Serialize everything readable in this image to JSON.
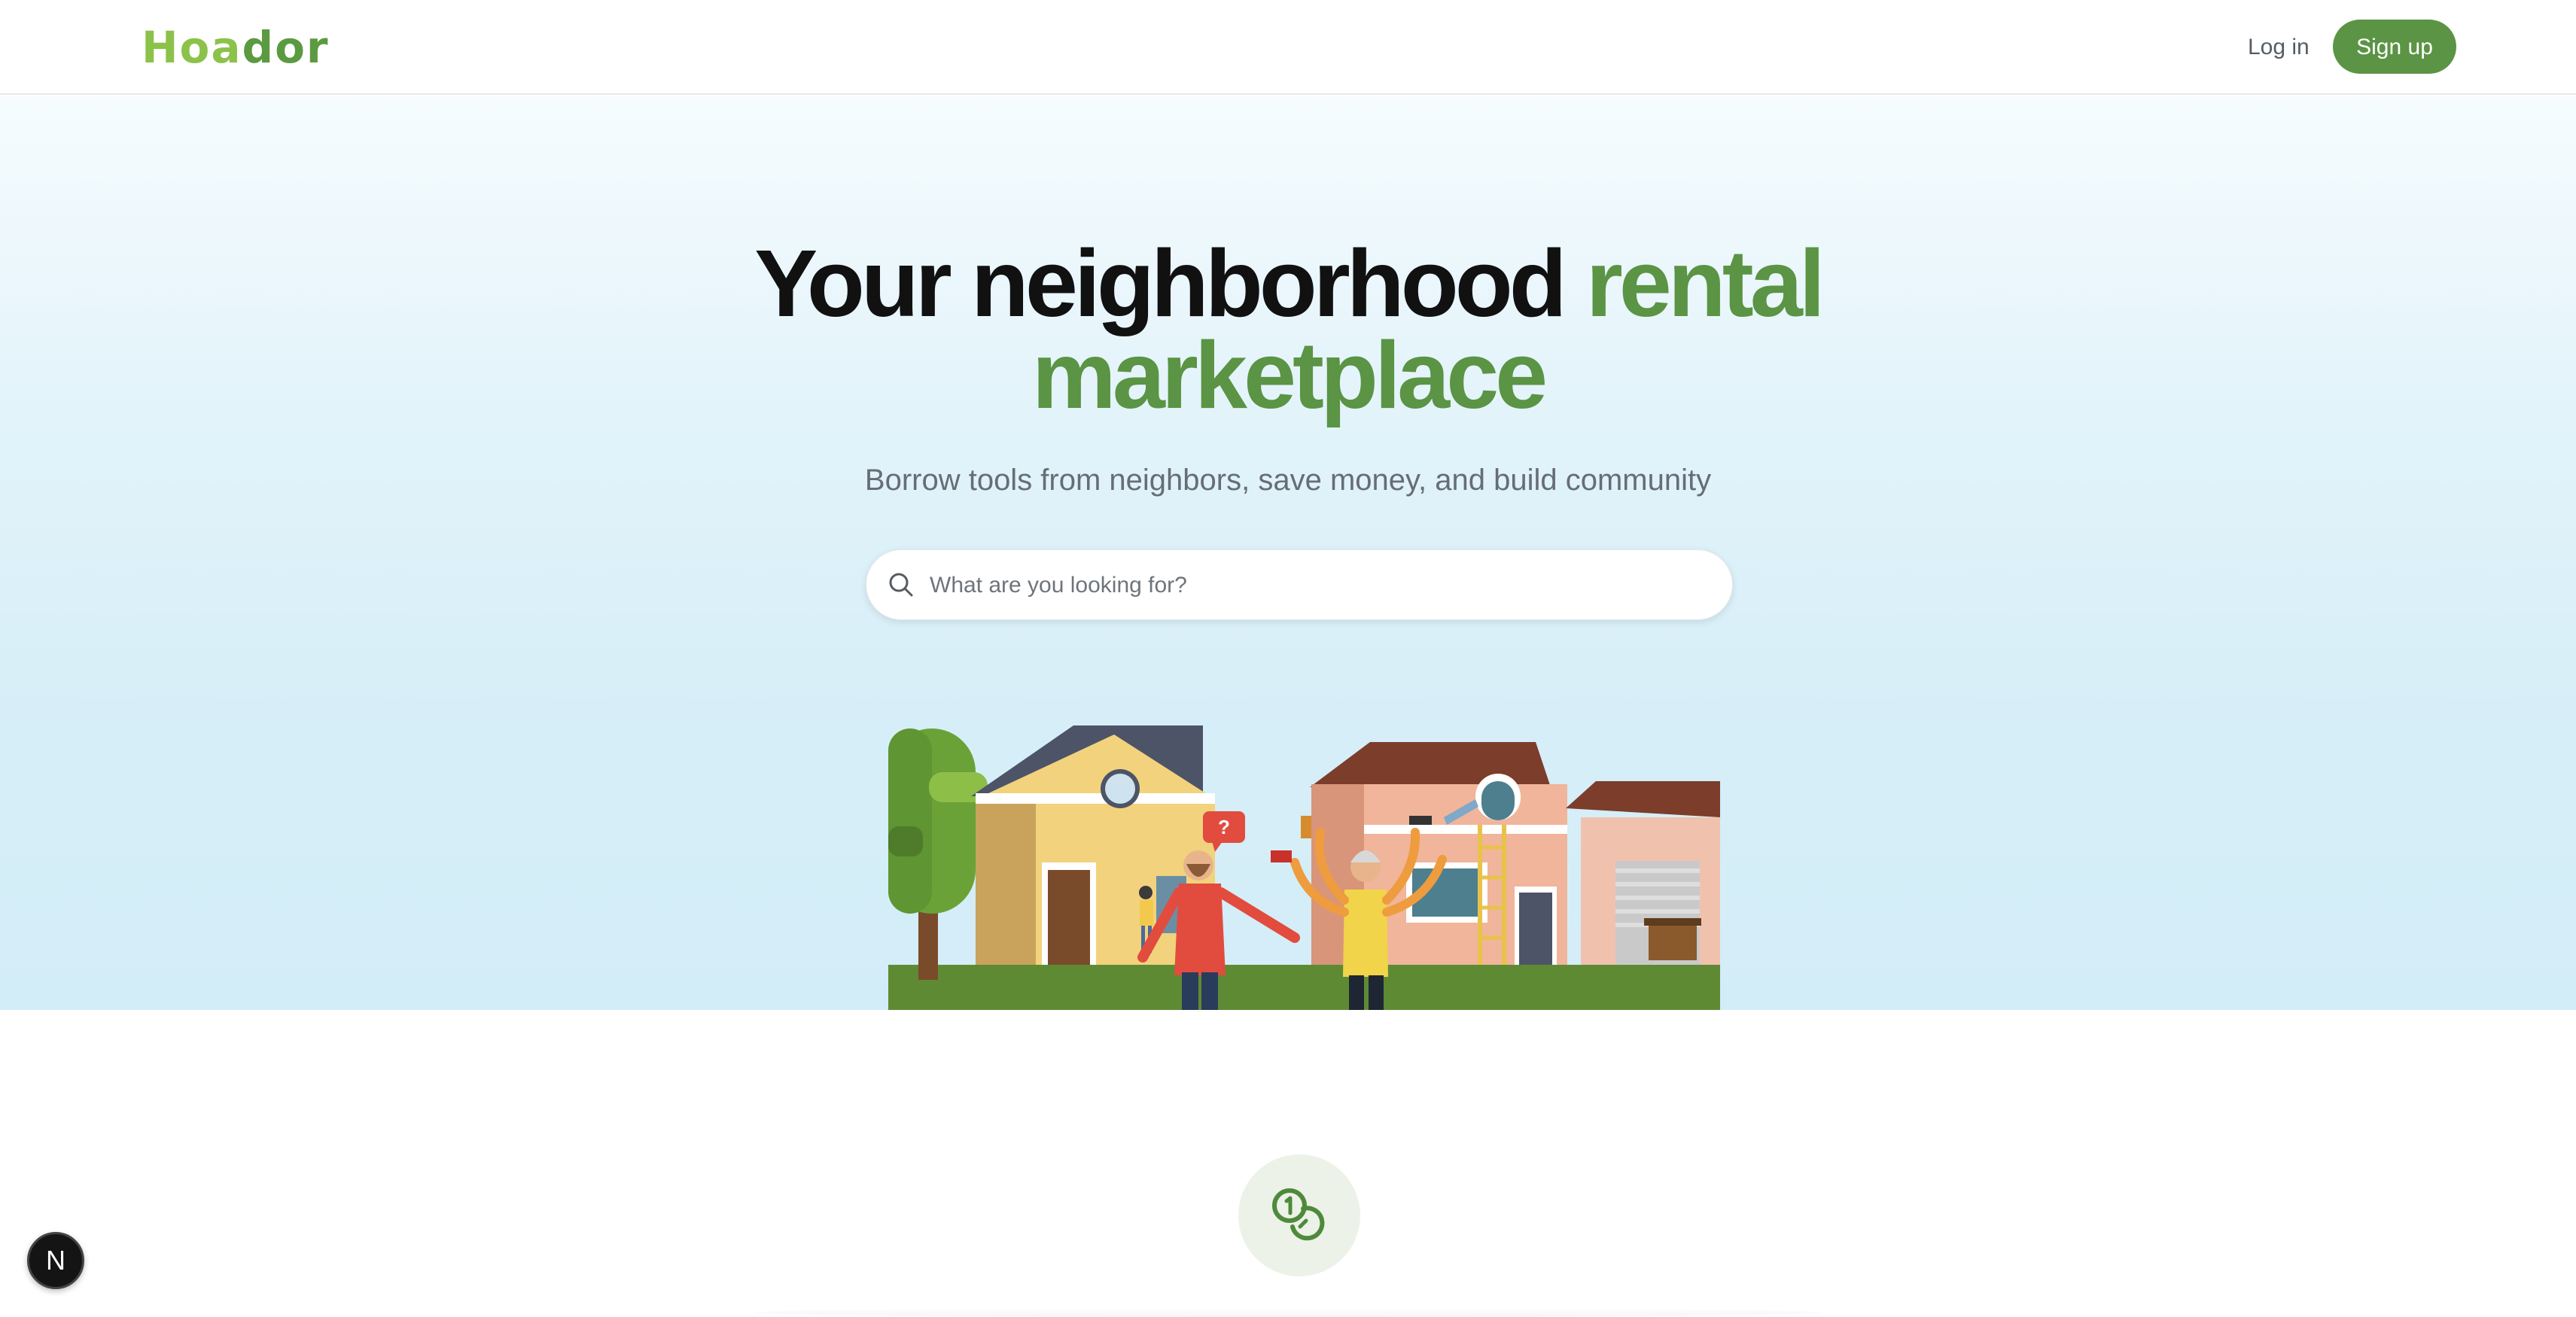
{
  "header": {
    "logo_part1": "H",
    "logo_part2": "oa",
    "logo_part3": "dor",
    "login_label": "Log in",
    "signup_label": "Sign up"
  },
  "hero": {
    "headline_dark": "Your neighborhood",
    "headline_green_1": "rental",
    "headline_green_2": "marketplace",
    "subtitle": "Borrow tools from neighbors, save money, and build community",
    "search_placeholder": "What are you looking for?",
    "speech_bubble": "?"
  },
  "dev_badge": {
    "letter": "N"
  },
  "colors": {
    "brand_green": "#5a9444",
    "logo_light_green": "#8cc24a",
    "hero_bg": "#d6eef8"
  },
  "icons": {
    "search": "search-icon",
    "coins": "coins-icon"
  }
}
